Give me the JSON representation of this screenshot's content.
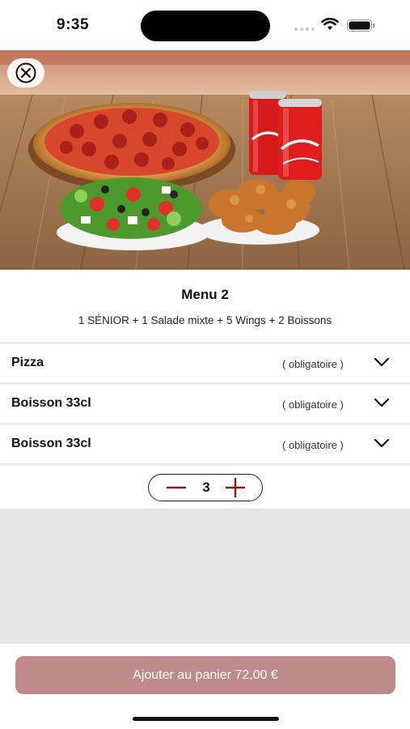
{
  "status_bar": {
    "time": "9:35"
  },
  "product": {
    "title": "Menu 2",
    "description": "1 SÉNIOR + 1 Salade mixte + 5 Wings + 2 Boissons"
  },
  "options": [
    {
      "label": "Pizza",
      "requirement": "( obligatoire )"
    },
    {
      "label": "Boisson 33cl",
      "requirement": "( obligatoire )"
    },
    {
      "label": "Boisson 33cl",
      "requirement": "( obligatoire )"
    }
  ],
  "quantity": {
    "value": "3"
  },
  "cart_button": {
    "label": "Ajouter au panier 72,00 €"
  },
  "colors": {
    "accent": "#bf8a8a",
    "stepper_icons": "#8b1a1a"
  }
}
